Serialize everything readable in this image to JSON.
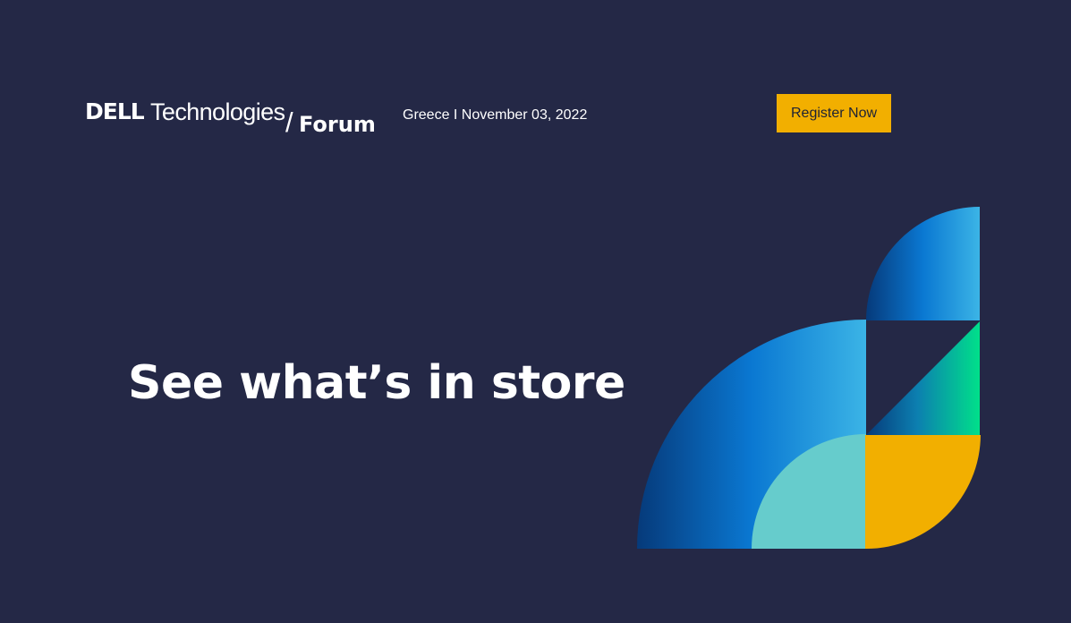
{
  "header": {
    "logo": {
      "dell": "DELL",
      "technologies": "Technologies",
      "slash": "/",
      "forum": "Forum"
    },
    "event_info": "Greece I November 03, 2022",
    "register_label": "Register Now"
  },
  "hero": {
    "headline": "See what’s in store"
  },
  "colors": {
    "background": "#242846",
    "accent_yellow": "#f2af00",
    "blue_light": "#3bb4e6",
    "blue_mid": "#0a78d2",
    "blue_dark": "#063a7a",
    "teal": "#66cccc",
    "green": "#00e08a"
  }
}
